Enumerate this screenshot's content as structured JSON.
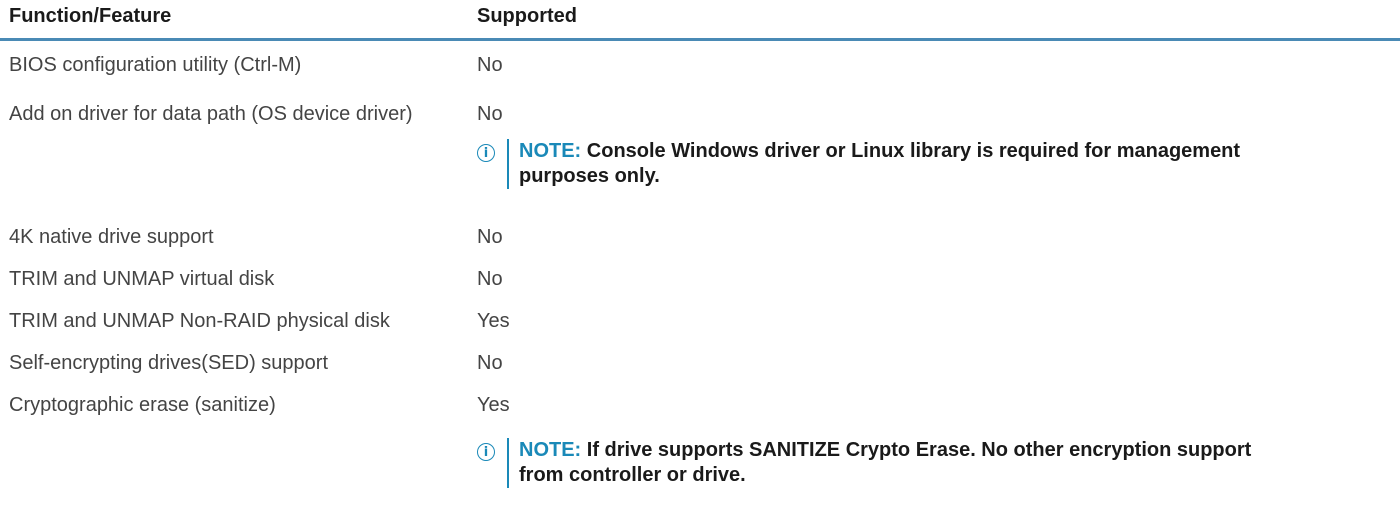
{
  "table": {
    "headers": {
      "feature": "Function/Feature",
      "supported": "Supported"
    },
    "rows": [
      {
        "feature": "BIOS configuration utility (Ctrl-M)",
        "supported": "No",
        "note": null
      },
      {
        "feature": "Add on driver for data path (OS device driver)",
        "supported": "No",
        "note": {
          "label": "NOTE:",
          "text": "Console Windows driver or Linux library is required for management purposes only."
        }
      },
      {
        "feature": "4K native drive support",
        "supported": "No",
        "note": null
      },
      {
        "feature": "TRIM and UNMAP virtual disk",
        "supported": "No",
        "note": null
      },
      {
        "feature": "TRIM and UNMAP Non-RAID physical disk",
        "supported": "Yes",
        "note": null
      },
      {
        "feature": "Self-encrypting drives(SED) support",
        "supported": "No",
        "note": null
      },
      {
        "feature": "Cryptographic erase (sanitize)",
        "supported": "Yes",
        "note": {
          "label": "NOTE:",
          "text": "If drive supports SANITIZE Crypto Erase. No other encryption support from controller or drive."
        }
      }
    ]
  },
  "colors": {
    "header_rule": "#4a8ab5",
    "note_accent": "#1a89b8",
    "body_text": "#444444",
    "header_text": "#1a1a1a"
  },
  "icons": {
    "note": "info-circle-icon"
  }
}
